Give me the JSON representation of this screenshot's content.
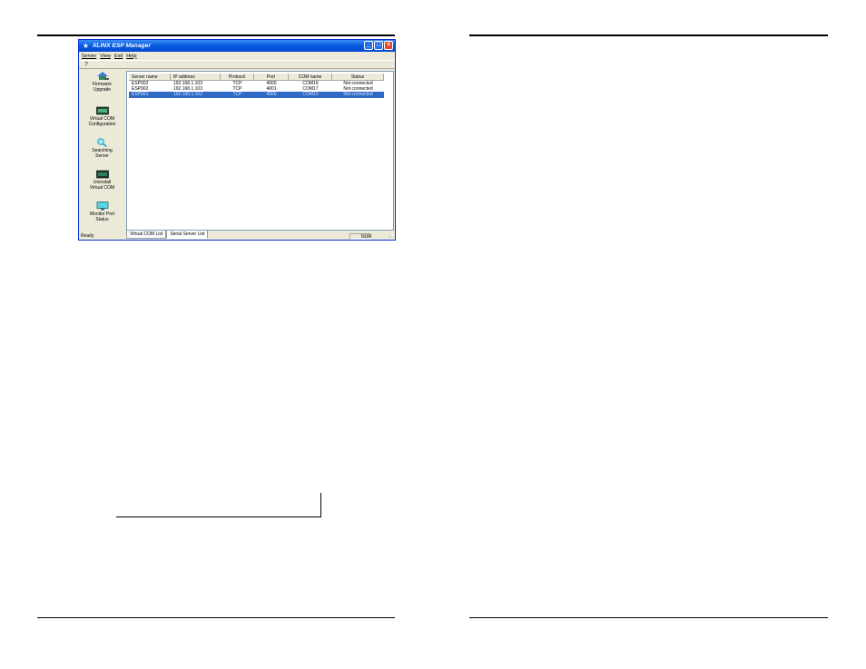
{
  "window": {
    "title": "XLINX ESP Manager",
    "title_icon": "xlinx-logo-icon",
    "colors": {
      "titlebar": "#0a5fe0",
      "selection": "#316ac5",
      "chrome": "#ece9d8",
      "close_button": "#e34a2a"
    }
  },
  "menu": {
    "items": [
      "Server",
      "View",
      "Exit",
      "Help"
    ]
  },
  "toolbar": {
    "icon": "question-help-icon"
  },
  "sidebar": {
    "items": [
      {
        "label": "Firmware\nUpgrade",
        "icon": "firmware-upgrade-icon"
      },
      {
        "label": "Virtual COM\nConfiguration",
        "icon": "virtual-com-config-icon"
      },
      {
        "label": "Searching\nServer",
        "icon": "magnifier-search-icon"
      },
      {
        "label": "Uninstall\nVirtual COM",
        "icon": "uninstall-com-icon"
      },
      {
        "label": "Monitor Port\nStatus",
        "icon": "monitor-icon"
      }
    ]
  },
  "list": {
    "columns": [
      "Server name",
      "IP address",
      "Protocol",
      "Port",
      "COM name",
      "Status"
    ],
    "rows": [
      [
        "ESP902",
        "192.168.1.103",
        "TCP",
        "4000",
        "COM16",
        "Not connected"
      ],
      [
        "ESP902",
        "192.168.1.103",
        "TCP",
        "4001",
        "COM17",
        "Not connected"
      ],
      [
        "ESP901",
        "192.168.1.102",
        "TCP",
        "4000",
        "COM15",
        "Not connected"
      ]
    ],
    "selected_row": 2
  },
  "tabs": [
    "Virtual COM List",
    "Serial Server List"
  ],
  "active_tab": 1,
  "status": {
    "text": "Ready",
    "indicator": "NUM"
  }
}
